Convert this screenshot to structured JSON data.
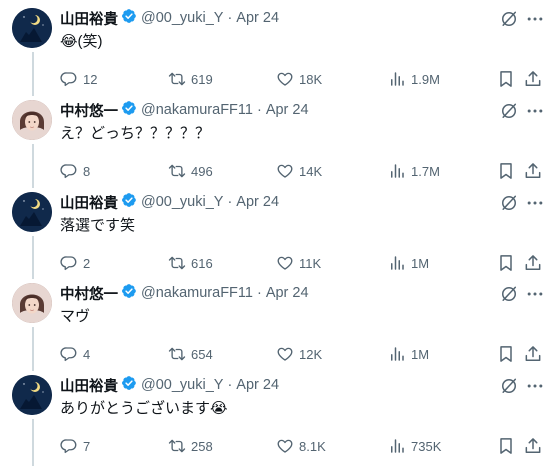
{
  "tweets": [
    {
      "author": "山田裕貴",
      "handle": "@00_yuki_Y",
      "date": "Apr 24",
      "text": "😂(笑)",
      "replies": "12",
      "retweets": "619",
      "likes": "18K",
      "views": "1.9M",
      "avatar": "yuki"
    },
    {
      "author": "中村悠一",
      "handle": "@nakamuraFF11",
      "date": "Apr 24",
      "text": "え？どっち？？？？？",
      "replies": "8",
      "retweets": "496",
      "likes": "14K",
      "views": "1.7M",
      "avatar": "naka"
    },
    {
      "author": "山田裕貴",
      "handle": "@00_yuki_Y",
      "date": "Apr 24",
      "text": "落選です笑",
      "replies": "2",
      "retweets": "616",
      "likes": "11K",
      "views": "1M",
      "avatar": "yuki"
    },
    {
      "author": "中村悠一",
      "handle": "@nakamuraFF11",
      "date": "Apr 24",
      "text": "マヴ",
      "replies": "4",
      "retweets": "654",
      "likes": "12K",
      "views": "1M",
      "avatar": "naka"
    },
    {
      "author": "山田裕貴",
      "handle": "@00_yuki_Y",
      "date": "Apr 24",
      "text": "ありがとうございます😭",
      "replies": "7",
      "retweets": "258",
      "likes": "8.1K",
      "views": "735K",
      "avatar": "yuki"
    }
  ],
  "icons": {
    "verified_color": "#1d9bf0",
    "secondary_text_color": "#536471"
  }
}
